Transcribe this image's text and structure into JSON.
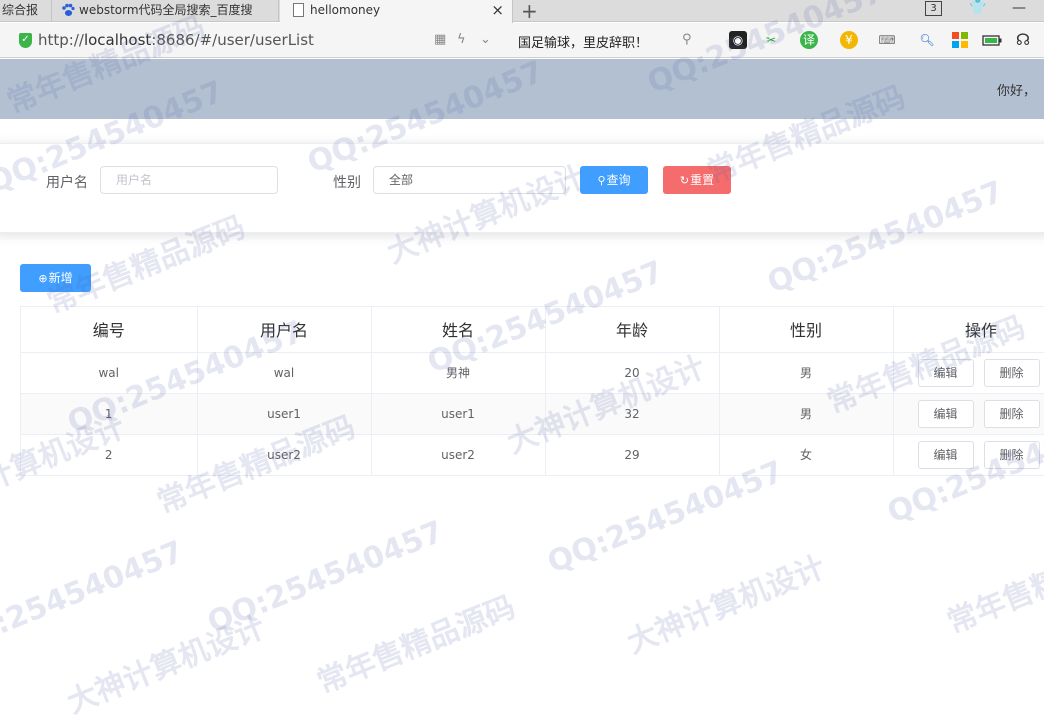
{
  "browser": {
    "tabs": [
      {
        "label": "综合报"
      },
      {
        "label": "webstorm代码全局搜索_百度搜"
      },
      {
        "label": "hellomoney",
        "close": "×"
      }
    ],
    "new_tab": "+",
    "window_count": "3",
    "url_prefix": "http://",
    "url_host": "localhost",
    "url_rest": ":8686/#/user/userList",
    "news": "国足输球，里皮辞职！"
  },
  "header": {
    "greeting": "你好，"
  },
  "search": {
    "username_label": "用户名",
    "username_placeholder": "用户名",
    "gender_label": "性别",
    "gender_value": "全部",
    "query_label": "查询",
    "reset_label": "重置"
  },
  "toolbar": {
    "add_label": "新增"
  },
  "table": {
    "columns": [
      "编号",
      "用户名",
      "姓名",
      "年龄",
      "性别",
      "操作"
    ],
    "rows": [
      [
        "wal",
        "wal",
        "男神",
        "20",
        "男"
      ],
      [
        "1",
        "user1",
        "user1",
        "32",
        "男"
      ],
      [
        "2",
        "user2",
        "user2",
        "29",
        "女"
      ]
    ],
    "edit_label": "编辑",
    "delete_label": "删除"
  },
  "watermark": {
    "qq": "QQ:254540457",
    "shop": "常年售精品源码",
    "design": "大神计算机设计"
  },
  "colors": {
    "primary": "#409eff",
    "danger": "#f56c6c",
    "header_bg": "#b3c0d1"
  }
}
